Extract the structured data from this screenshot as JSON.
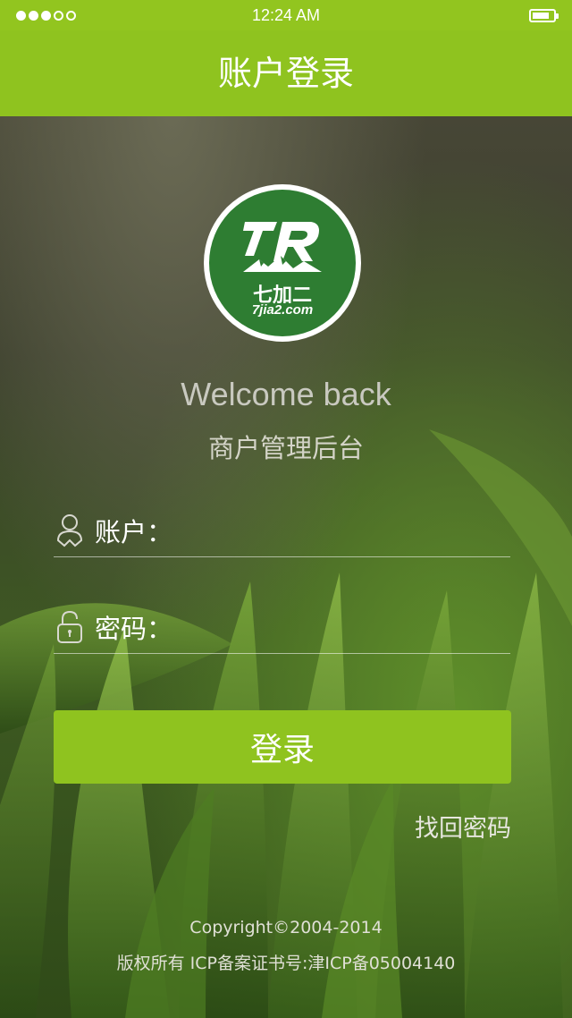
{
  "status_bar": {
    "time": "12:24 AM",
    "signal_bars_filled": 3,
    "signal_bars_total": 5
  },
  "nav": {
    "title": "账户登录"
  },
  "logo": {
    "mark": "7R",
    "name_cn": "七加二",
    "url": "7jia2.com"
  },
  "welcome": {
    "title": "Welcome back",
    "subtitle": "商户管理后台"
  },
  "form": {
    "account_label": "账户：",
    "account_value": "",
    "password_label": "密码：",
    "password_value": "",
    "account_icon": "user-icon",
    "password_icon": "lock-icon"
  },
  "login_button": {
    "label": "登录"
  },
  "forgot_link": {
    "label": "找回密码"
  },
  "footer": {
    "copyright": "Copyright©2004-2014",
    "icp": "版权所有  ICP备案证书号:津ICP备05004140"
  },
  "colors": {
    "accent": "#8fc31f",
    "logo_green": "#2e7d32"
  }
}
